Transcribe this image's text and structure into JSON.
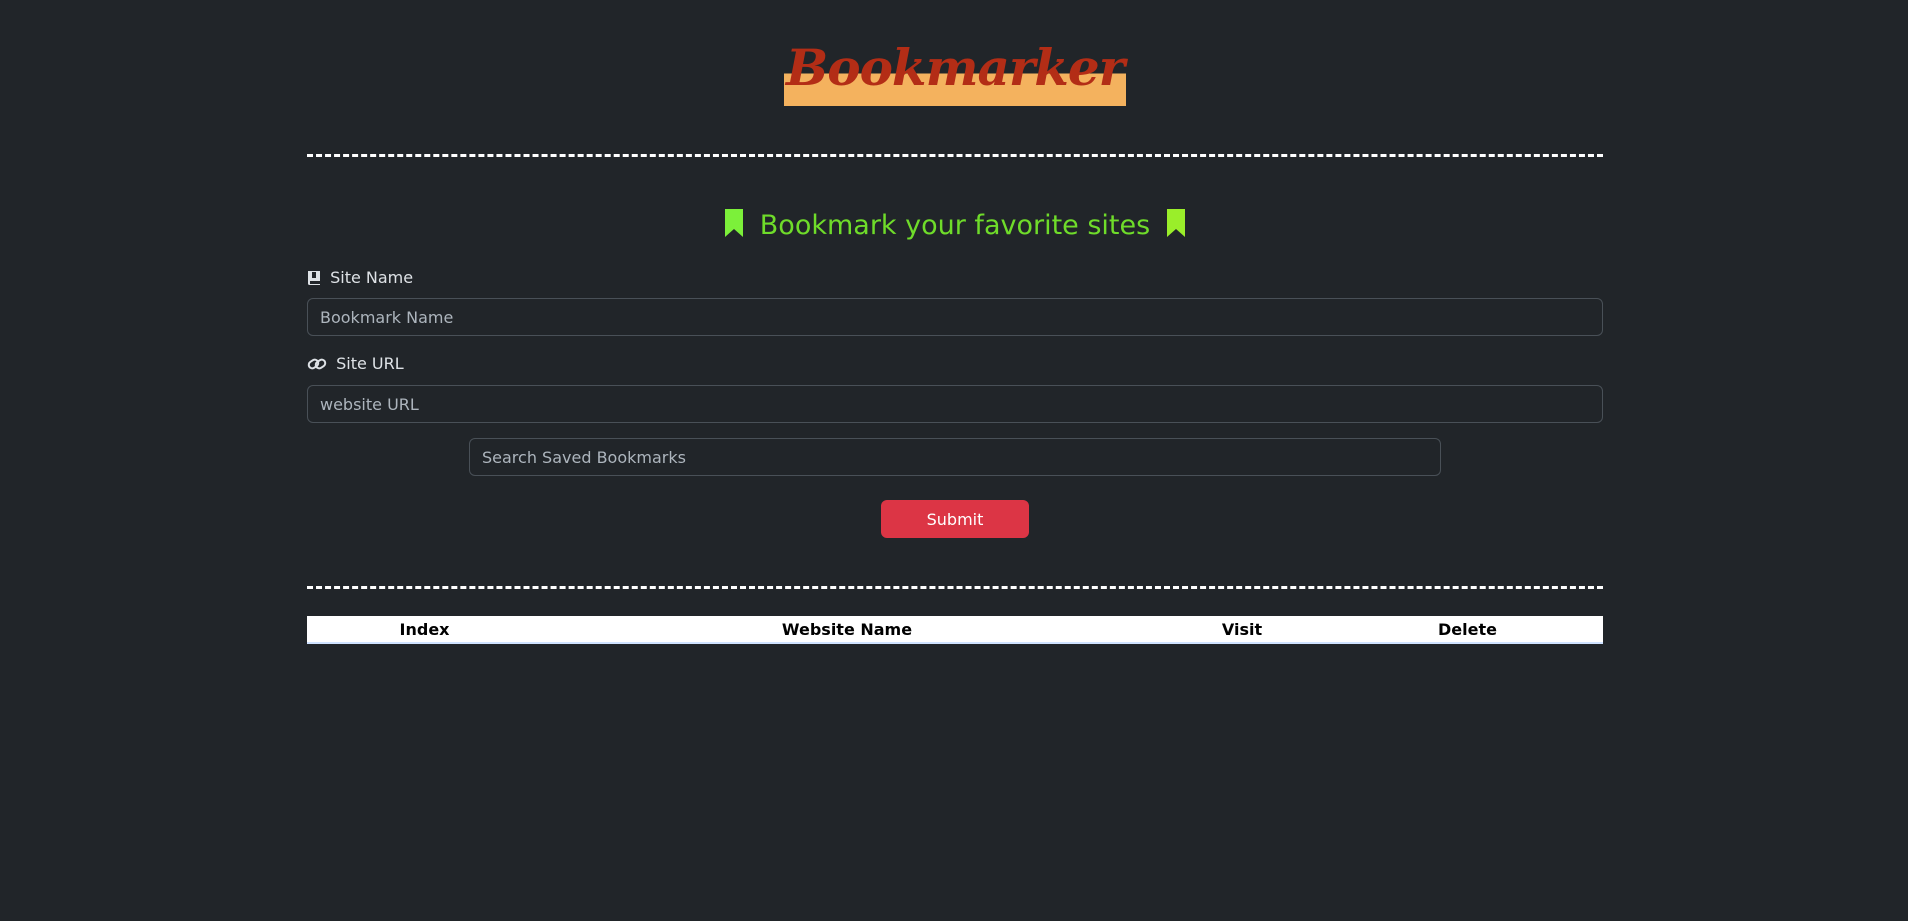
{
  "app": {
    "title": "Bookmarker"
  },
  "form": {
    "heading": "Bookmark your favorite sites",
    "site_name_label": "Site Name",
    "site_name_placeholder": "Bookmark Name",
    "site_url_label": "Site URL",
    "site_url_placeholder": "website URL",
    "search_placeholder": "Search Saved Bookmarks",
    "submit_label": "Submit"
  },
  "table": {
    "columns": [
      "Index",
      "Website Name",
      "Visit",
      "Delete"
    ],
    "rows": []
  },
  "colors": {
    "background": "#212529",
    "brand_text": "#b32d16",
    "brand_highlight": "#f4b25e",
    "heading": "#6fdc2a",
    "bookmark_icon": "#7cf03a",
    "submit": "#dc3545"
  },
  "icons": {
    "heading_left": "bookmark-icon",
    "heading_right": "bookmark-icon",
    "site_name": "book-icon",
    "site_url": "link-icon"
  }
}
